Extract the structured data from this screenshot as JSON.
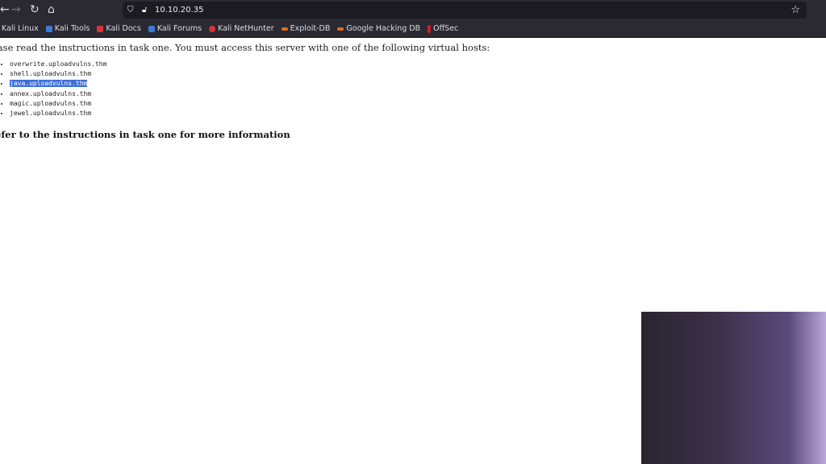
{
  "browser": {
    "url": "10.10.20.35",
    "bookmarks": [
      {
        "label": "Kali Linux",
        "color": "#3a7bd5"
      },
      {
        "label": "Kali Tools",
        "color": "#3a7bd5"
      },
      {
        "label": "Kali Docs",
        "color": "#d33"
      },
      {
        "label": "Kali Forums",
        "color": "#3a7bd5"
      },
      {
        "label": "Kali NetHunter",
        "color": "#d33"
      },
      {
        "label": "Exploit-DB",
        "color": "#e0701a"
      },
      {
        "label": "Google Hacking DB",
        "color": "#e0701a"
      },
      {
        "label": "OffSec",
        "color": "#c22"
      }
    ]
  },
  "page": {
    "intro": "ease read the instructions in task one. You must access this server with one of the following virtual hosts:",
    "hosts": [
      "overwrite.uploadvulns.thm",
      "shell.uploadvulns.thm",
      "java.uploadvulns.thm",
      "annex.uploadvulns.thm",
      "magic.uploadvulns.thm",
      "jewel.uploadvulns.thm"
    ],
    "footer": "efer to the instructions in task one for more information"
  }
}
